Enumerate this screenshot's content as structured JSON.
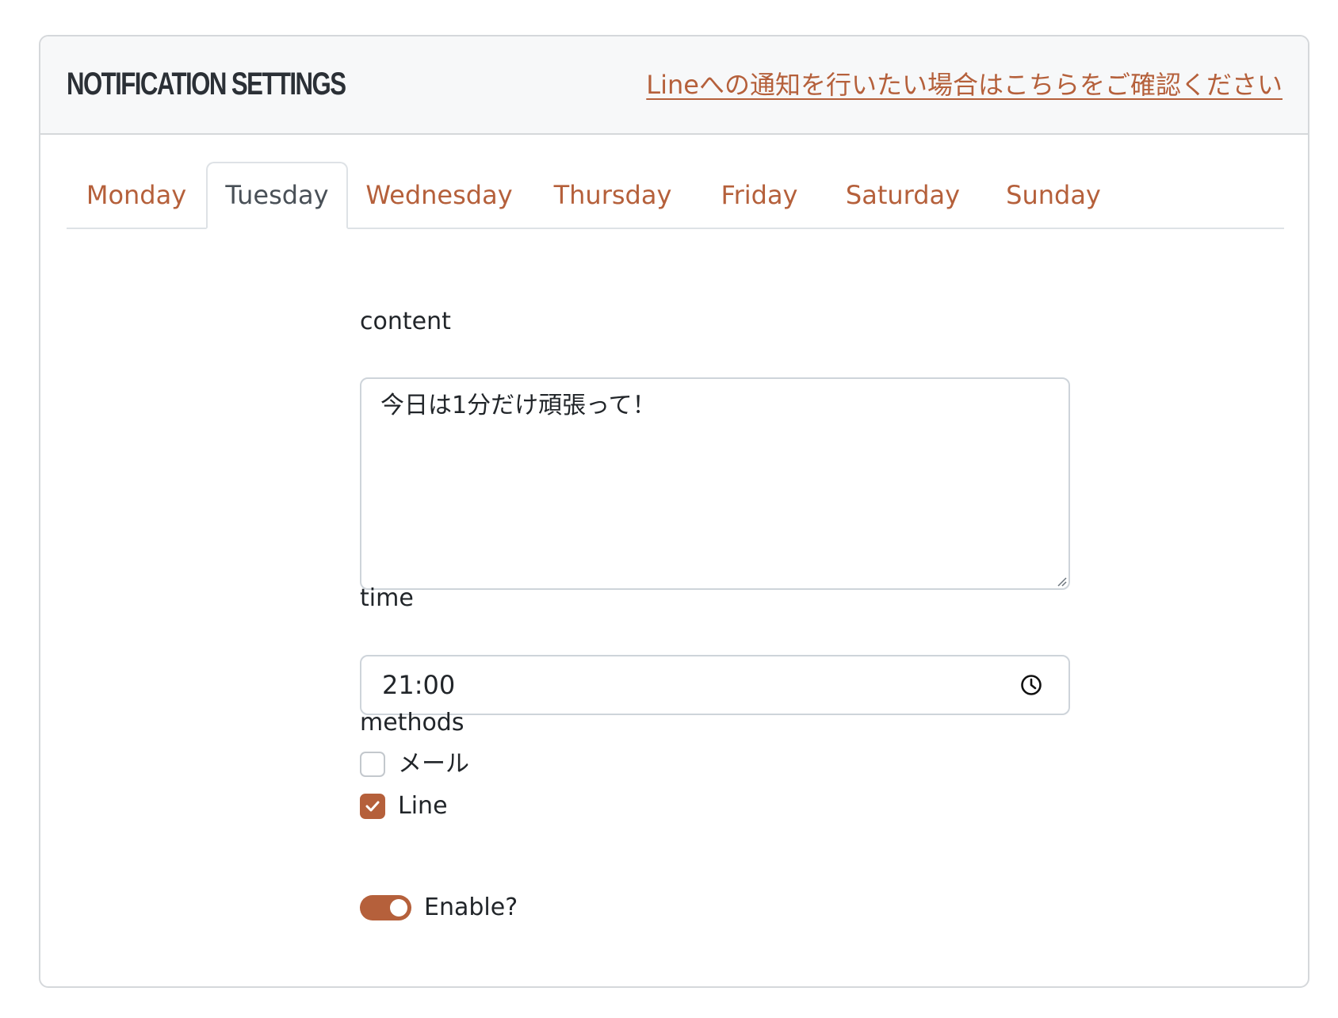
{
  "header": {
    "title": "NOTIFICATION SETTINGS",
    "line_link": "Lineへの通知を行いたい場合はこちらをご確認ください"
  },
  "tabs": [
    {
      "label": "Monday",
      "active": false
    },
    {
      "label": "Tuesday",
      "active": true
    },
    {
      "label": "Wednesday",
      "active": false
    },
    {
      "label": "Thursday",
      "active": false
    },
    {
      "label": "Friday",
      "active": false
    },
    {
      "label": "Saturday",
      "active": false
    },
    {
      "label": "Sunday",
      "active": false
    }
  ],
  "form": {
    "content": {
      "label": "content",
      "value": "今日は1分だけ頑張って！"
    },
    "time": {
      "label": "time",
      "value": "21:00",
      "icon": "clock-icon"
    },
    "methods": {
      "label": "methods",
      "options": [
        {
          "label": "メール",
          "checked": false
        },
        {
          "label": "Line",
          "checked": true
        }
      ]
    },
    "enable": {
      "label": "Enable?",
      "on": true
    }
  },
  "colors": {
    "accent": "#b5603b",
    "header_bg": "#f7f8f9",
    "border": "#ced4da",
    "title": "#2b3036"
  }
}
